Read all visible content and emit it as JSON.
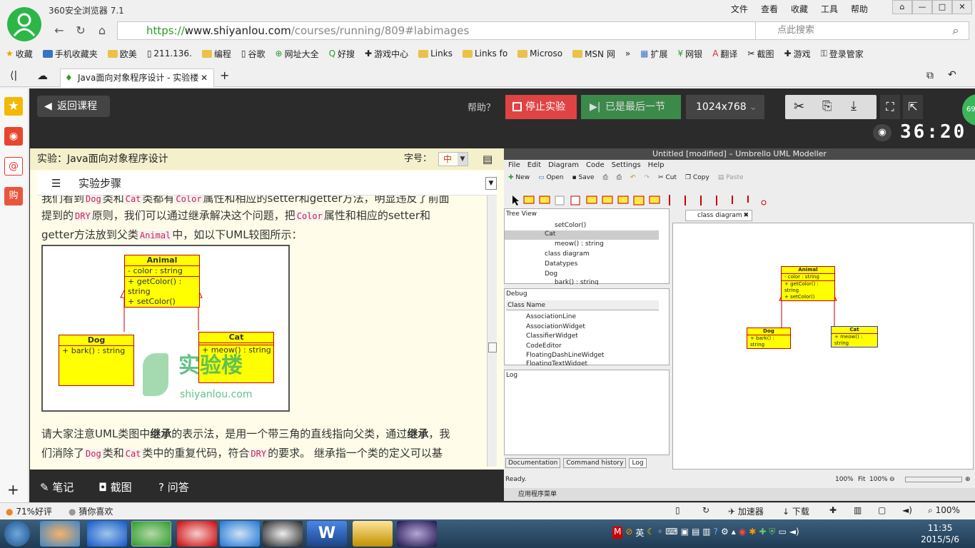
{
  "browser": {
    "app_title": "360安全浏览器 7.1",
    "menu": [
      "文件",
      "查看",
      "收藏",
      "工具",
      "帮助"
    ],
    "url_secure": "https://",
    "url_domain": "www.shiyanlou.com",
    "url_path": "/courses/running/809#labimages",
    "search_placeholder": "点此搜索",
    "bookmarks": [
      "收藏",
      "手机收藏夹",
      "欧美",
      "211.136.",
      "编程",
      "谷歌",
      "网址大全",
      "好搜",
      "游戏中心",
      "Links",
      "Links fo",
      "Microso",
      "MSN 网"
    ],
    "right_tools": [
      "扩展",
      "网银",
      "翻译",
      "截图",
      "游戏",
      "登录管家"
    ],
    "tab_title": "Java面向对象程序设计 - 实验楼"
  },
  "page": {
    "back_label": "返回课程",
    "help_label": "帮助？",
    "stop_label": "停止实验",
    "last_label": "已是最后一节",
    "resolution": "1024x768",
    "timer": "36:20",
    "badge": "69"
  },
  "lesson": {
    "header": "实验：Java面向对象程序设计",
    "fontsize_label": "字号：",
    "fontsize_value": "中",
    "steps_label": "实验步骤",
    "para1_a": "我们看到",
    "para1_code1": "Dog",
    "para1_b": "类和",
    "para1_code2": "Cat",
    "para1_c": "类都有",
    "para1_code3": "Color",
    "para1_d": "属性和相应的setter和getter方法，明显违反了前面",
    "para2_a": "提到的",
    "para2_code1": "DRY",
    "para2_b": "原则，我们可以通过继承解决这个问题，把",
    "para2_code2": "Color",
    "para2_c": "属性和相应的setter和",
    "para3_a": "getter方法放到父类",
    "para3_code1": "Animal",
    "para3_b": "中，如以下UML较图所示：",
    "watermark": "实验楼",
    "watermark_url": "shiyanlou.com",
    "para4_a": "请大家注意UML类图中",
    "para4_b": "继承",
    "para4_c": "的表示法，是用一个带三角的直线指向父类，通过",
    "para4_d": "继承",
    "para4_e": "，我",
    "para5_a": "们消除了",
    "para5_code1": "Dog",
    "para5_b": "类和",
    "para5_code2": "Cat",
    "para5_c": "类中的重复代码，符合",
    "para5_code3": "DRY",
    "para5_d": "的要求。 继承指一个类的定义可以基",
    "footer": [
      "笔记",
      "截图",
      "问答"
    ]
  },
  "uml": {
    "animal": {
      "name": "Animal",
      "attr": "- color : string",
      "ops": [
        "+ getColor() : string",
        "+ setColor()"
      ]
    },
    "dog": {
      "name": "Dog",
      "ops": [
        "+ bark() : string"
      ]
    },
    "cat": {
      "name": "Cat",
      "ops": [
        "+ meow() : string"
      ]
    }
  },
  "umbrello": {
    "title": "Untitled [modified] – Umbrello UML Modeller",
    "menu": [
      "File",
      "Edit",
      "Diagram",
      "Code",
      "Settings",
      "Help"
    ],
    "toolbar": [
      "New",
      "Open",
      "Save",
      "Cut",
      "Copy",
      "Paste"
    ],
    "tree_header": "Tree View",
    "tree_rows": [
      "setColor()",
      "Cat",
      "meow() : string",
      "class diagram",
      "Datatypes",
      "Dog",
      "bark() : string"
    ],
    "debug_header": "Debug",
    "debug_col": "Class Name",
    "debug_rows": [
      "AssociationLine",
      "AssociationWidget",
      "ClassifierWidget",
      "CodeEditor",
      "FloatingDashLineWidget",
      "FloatingTextWidget"
    ],
    "log_header": "Log",
    "bottom_tabs": [
      "Documentation",
      "Command history",
      "Log"
    ],
    "diagram_tab": "class diagram",
    "status": "Ready.",
    "zoom": "100%",
    "fit": "Fit",
    "zoom2": "100%",
    "taskbar": "应用程序菜单"
  },
  "status_bar": {
    "rating": "71%好评",
    "guess": "猜你喜欢",
    "accelerator": "加速器",
    "download": "下载",
    "zoom": "100%"
  },
  "taskbar": {
    "time": "11:35",
    "date": "2015/5/6",
    "ime": "英"
  }
}
